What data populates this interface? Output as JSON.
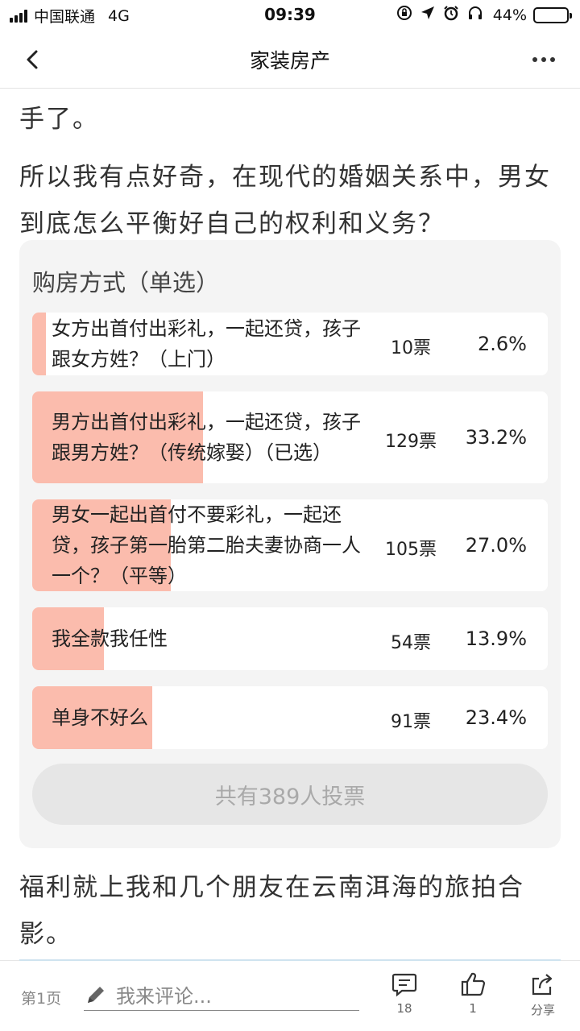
{
  "status_bar": {
    "carrier": "中国联通",
    "network": "4G",
    "time": "09:39",
    "battery": "44%",
    "battery_level": 0.44,
    "icons": [
      "signal-icon",
      "lock-rotation-icon",
      "location-icon",
      "alarm-icon",
      "headphones-icon",
      "battery-icon"
    ]
  },
  "nav": {
    "title": "家装房产",
    "back_icon": "chevron-left-icon",
    "more_icon": "more-dots-icon"
  },
  "article": {
    "para1": "手了。",
    "para2": "所以我有点好奇，在现代的婚姻关系中，男女到底怎么平衡好自己的权利和义务？",
    "para3": "福利就上我和几个朋友在云南洱海的旅拍合影。"
  },
  "poll": {
    "title": "购房方式（单选）",
    "bar_color": "#fbbcad",
    "options": [
      {
        "label": "女方出首付出彩礼，一起还贷，孩子跟女方姓？（上门）",
        "votes": "10票",
        "percent": "2.6%",
        "share": 0.026
      },
      {
        "label": "男方出首付出彩礼，一起还贷，孩子跟男方姓？（传统嫁娶）（已选）",
        "votes": "129票",
        "percent": "33.2%",
        "share": 0.332
      },
      {
        "label": "男女一起出首付不要彩礼，一起还贷，孩子第一胎第二胎夫妻协商一人一个？（平等）",
        "votes": "105票",
        "percent": "27.0%",
        "share": 0.27
      },
      {
        "label": "我全款我任性",
        "votes": "54票",
        "percent": "13.9%",
        "share": 0.139
      },
      {
        "label": "单身不好么",
        "votes": "91票",
        "percent": "23.4%",
        "share": 0.234
      }
    ],
    "total": "共有389人投票"
  },
  "bottom": {
    "page": "第1页",
    "comment_placeholder": "我来评论...",
    "comments_count": "18",
    "likes_count": "1",
    "share_label": "分享"
  }
}
